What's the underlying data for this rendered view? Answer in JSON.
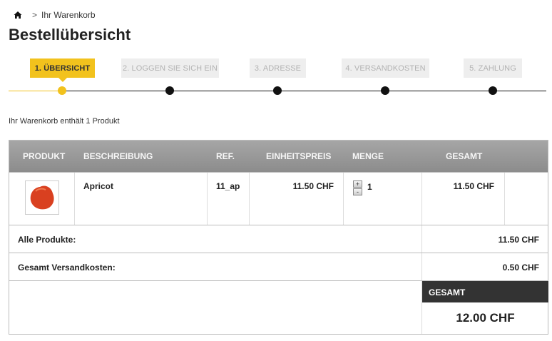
{
  "breadcrumb": {
    "home_icon": "home-icon",
    "separator": ">",
    "current": "Ihr Warenkorb"
  },
  "page_title": "Bestellübersicht",
  "steps": [
    {
      "label": "1. ÜBERSICHT",
      "active": true
    },
    {
      "label": "2. LOGGEN SIE SICH EIN",
      "active": false
    },
    {
      "label": "3. ADRESSE",
      "active": false
    },
    {
      "label": "4. VERSANDKOSTEN",
      "active": false
    },
    {
      "label": "5. ZAHLUNG",
      "active": false
    }
  ],
  "cart_summary": "Ihr Warenkorb enthält 1 Produkt",
  "table": {
    "headers": {
      "product": "PRODUKT",
      "description": "BESCHREIBUNG",
      "ref": "REF.",
      "unit_price": "EINHEITSPREIS",
      "quantity": "MENGE",
      "total": "GESAMT"
    },
    "items": [
      {
        "image_icon": "apricot-image",
        "description": "Apricot",
        "ref": "11_ap",
        "unit_price": "11.50 CHF",
        "quantity": "1",
        "total": "11.50 CHF",
        "qty_up_label": "+",
        "qty_down_label": "-"
      }
    ]
  },
  "totals": {
    "products_label": "Alle Produkte:",
    "products_value": "11.50 CHF",
    "shipping_label": "Gesamt Versandkosten:",
    "shipping_value": "0.50 CHF",
    "grand_label": "GESAMT",
    "grand_value": "12.00 CHF"
  },
  "colors": {
    "accent": "#f2c21d",
    "header_gray": "#999999",
    "grand_header": "#333333"
  }
}
